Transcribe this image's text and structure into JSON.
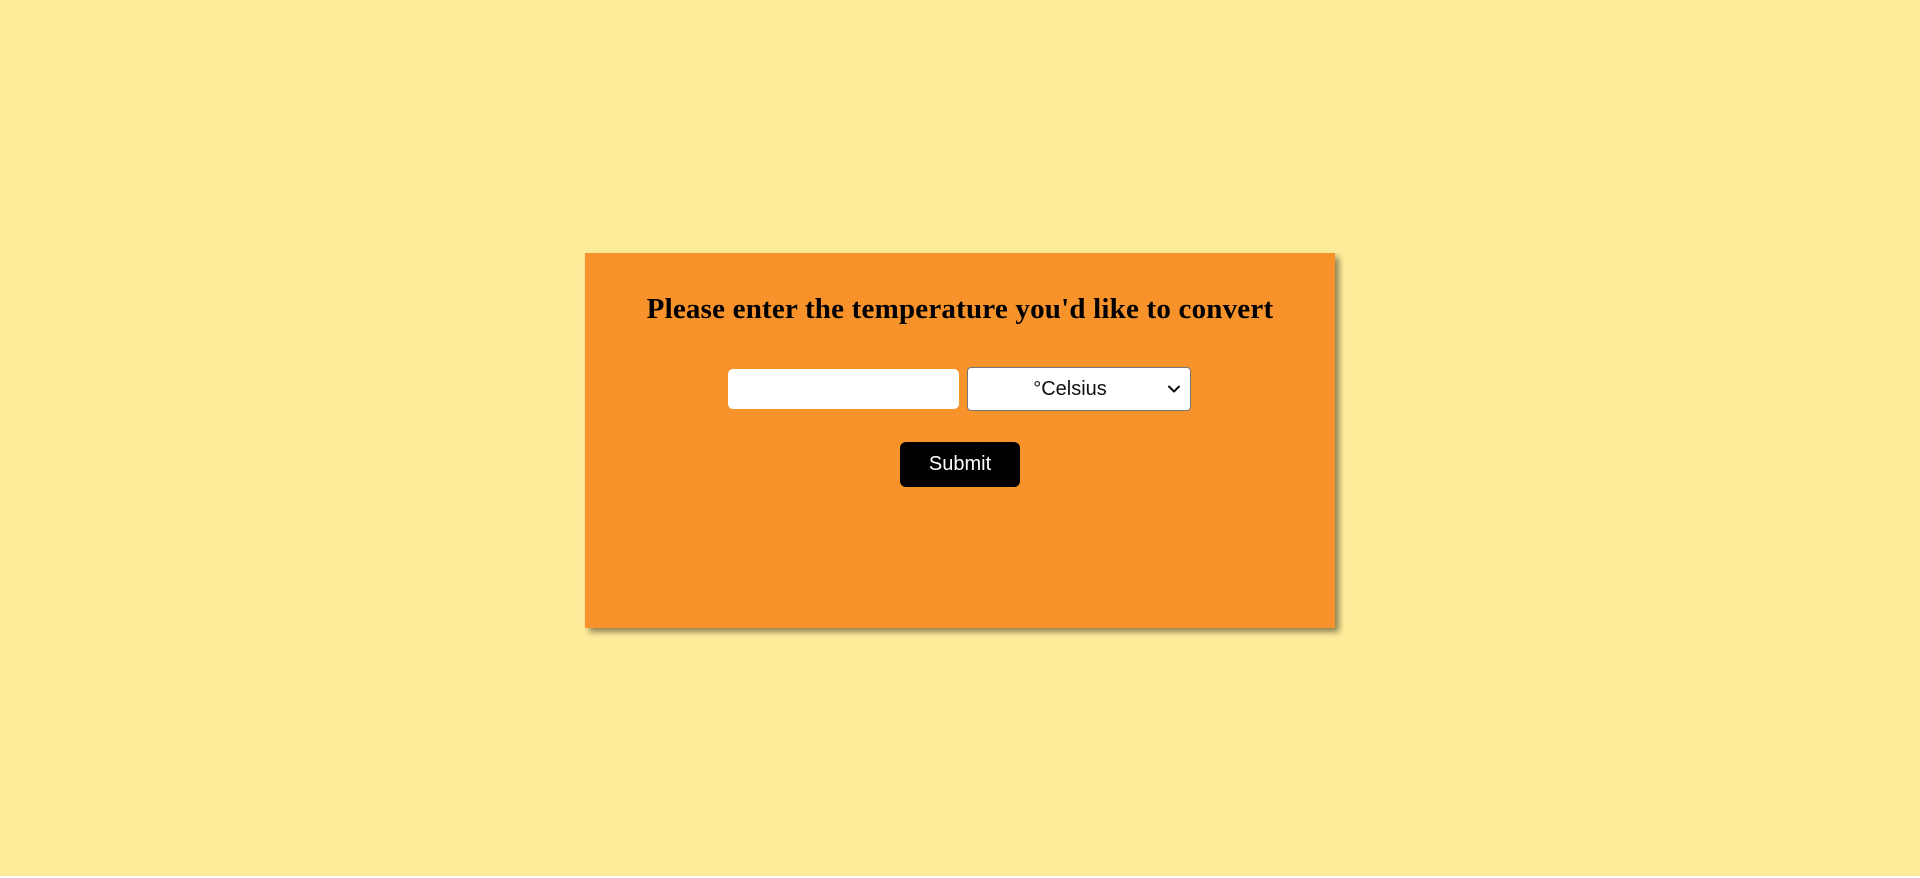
{
  "converter": {
    "title": "Please enter the temperature you'd like to convert",
    "temperature_input": {
      "value": "",
      "placeholder": ""
    },
    "unit_select": {
      "selected": "°Celsius"
    },
    "submit_label": "Submit"
  },
  "colors": {
    "page_background": "#ffec9b",
    "card_background": "#f7932a",
    "button_background": "#000000",
    "button_text": "#ffffff"
  },
  "icons": {
    "select_arrow": "chevron-down-icon"
  }
}
